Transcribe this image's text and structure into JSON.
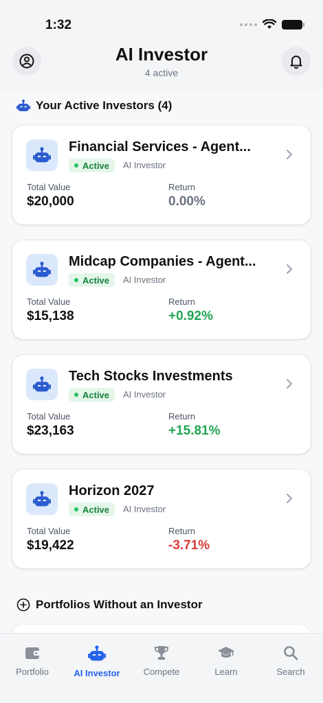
{
  "status": {
    "time": "1:32"
  },
  "header": {
    "title": "AI Investor",
    "subtitle": "4 active"
  },
  "sections": {
    "active_title": "Your Active Investors (4)",
    "without_title": "Portfolios Without an Investor"
  },
  "labels": {
    "total_value": "Total Value",
    "return": "Return"
  },
  "investors": [
    {
      "name": "Financial Services - Agent...",
      "status": "Active",
      "type": "AI Investor",
      "total_value": "$20,000",
      "return": "0.00%",
      "return_trend": "neutral"
    },
    {
      "name": "Midcap Companies - Agent...",
      "status": "Active",
      "type": "AI Investor",
      "total_value": "$15,138",
      "return": "+0.92%",
      "return_trend": "positive"
    },
    {
      "name": "Tech Stocks Investments",
      "status": "Active",
      "type": "AI Investor",
      "total_value": "$23,163",
      "return": "+15.81%",
      "return_trend": "positive"
    },
    {
      "name": "Horizon 2027",
      "status": "Active",
      "type": "AI Investor",
      "total_value": "$19,422",
      "return": "-3.71%",
      "return_trend": "negative"
    }
  ],
  "tabs": [
    {
      "label": "Portfolio",
      "icon": "wallet-icon",
      "active": false
    },
    {
      "label": "AI Investor",
      "icon": "robot-icon",
      "active": true
    },
    {
      "label": "Compete",
      "icon": "trophy-icon",
      "active": false
    },
    {
      "label": "Learn",
      "icon": "graduation-cap-icon",
      "active": false
    },
    {
      "label": "Search",
      "icon": "search-icon",
      "active": false
    }
  ],
  "colors": {
    "accent": "#2563eb",
    "positive": "#22a553",
    "negative": "#dc3b3b",
    "active_badge_bg": "#e4f6e9",
    "active_badge_text": "#15803d"
  }
}
